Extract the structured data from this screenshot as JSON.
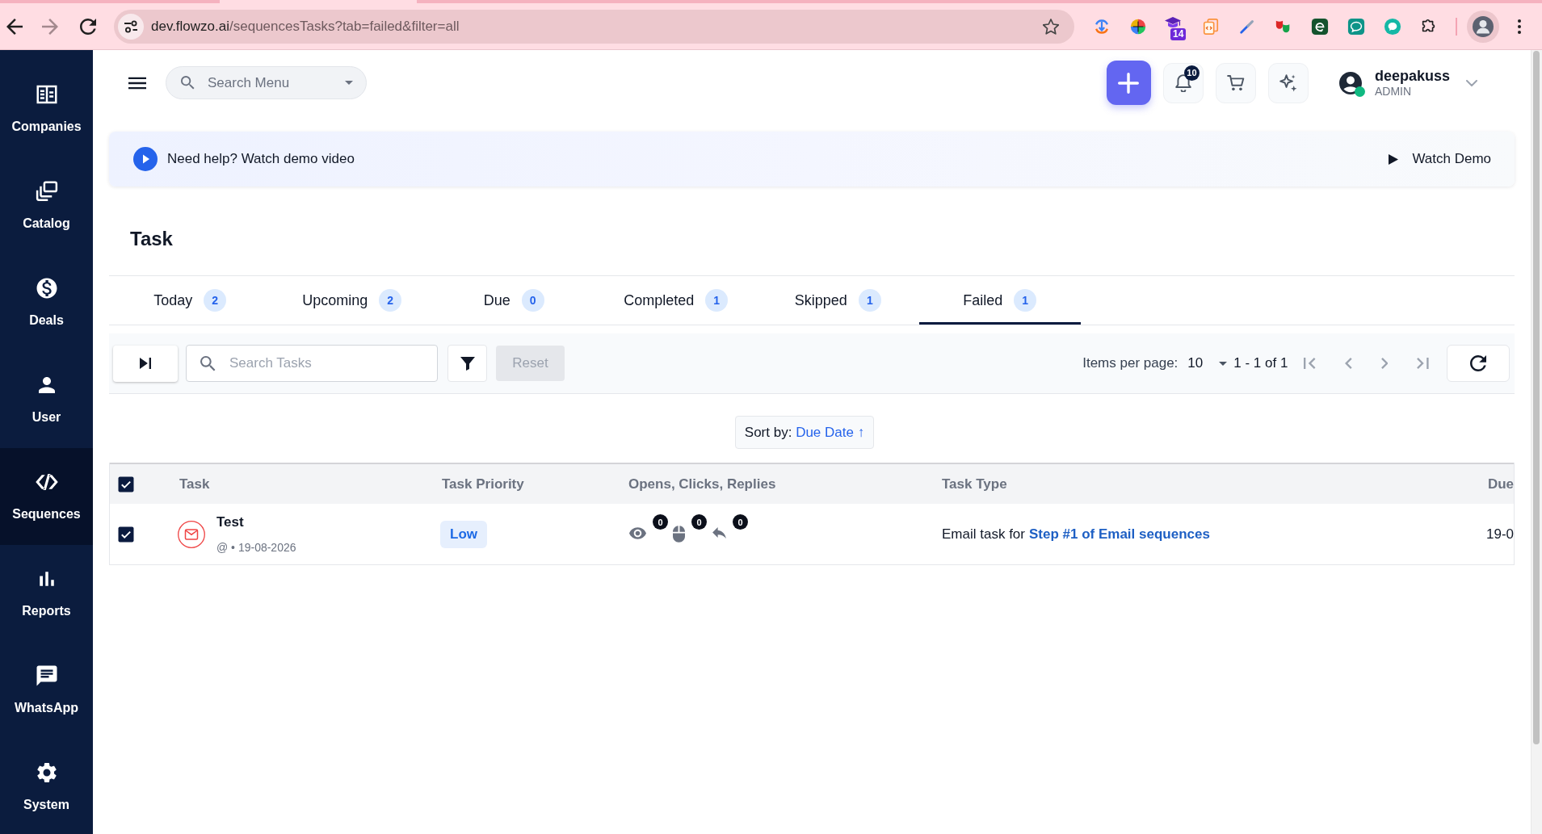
{
  "browser": {
    "address_bar": {
      "host": "dev.flowzo.ai",
      "path": "/sequencesTasks?tab=failed&filter=all"
    },
    "forward_disabled": true,
    "extension_badge": "14"
  },
  "sidebar": {
    "items": [
      {
        "label": "Companies",
        "selected": false
      },
      {
        "label": "Catalog",
        "selected": false
      },
      {
        "label": "Deals",
        "selected": false
      },
      {
        "label": "User",
        "selected": false
      },
      {
        "label": "Sequences",
        "selected": true
      },
      {
        "label": "Reports",
        "selected": false
      },
      {
        "label": "WhatsApp",
        "selected": false
      },
      {
        "label": "System",
        "selected": false
      }
    ]
  },
  "header": {
    "menu_search": {
      "placeholder": "Search Menu"
    },
    "notification_count": "10",
    "user": {
      "name": "deepakuss",
      "role": "ADMIN",
      "online": true
    }
  },
  "help_banner": {
    "text": "Need help? Watch demo video",
    "action": "Watch Demo"
  },
  "page_title": "Task",
  "tabs": [
    {
      "label": "Today",
      "count": "2",
      "selected": false
    },
    {
      "label": "Upcoming",
      "count": "2",
      "selected": false
    },
    {
      "label": "Due",
      "count": "0",
      "selected": false
    },
    {
      "label": "Completed",
      "count": "1",
      "selected": false
    },
    {
      "label": "Skipped",
      "count": "1",
      "selected": false
    },
    {
      "label": "Failed",
      "count": "1",
      "selected": true
    }
  ],
  "toolbar": {
    "search": {
      "placeholder": "Search Tasks"
    },
    "reset": {
      "label": "Reset",
      "disabled": true
    },
    "items_per_page_label": "Items per page:",
    "items_per_page": "10",
    "range": "1 - 1 of 1",
    "page_buttons_disabled": true
  },
  "sort": {
    "label": "Sort by:",
    "field": "Due Date ↑"
  },
  "table": {
    "all_checked": true,
    "columns": [
      "Task",
      "Task Priority",
      "Opens, Clicks, Replies",
      "Task Type",
      "Due"
    ],
    "rows": [
      {
        "checked": true,
        "title": "Test",
        "meta": "@ • 19-08-2026",
        "priority": "Low",
        "opens": "0",
        "clicks": "0",
        "replies": "0",
        "task_type": "Email task for",
        "task_step": "Step #1 of Email sequences",
        "due": "19-0"
      }
    ]
  }
}
